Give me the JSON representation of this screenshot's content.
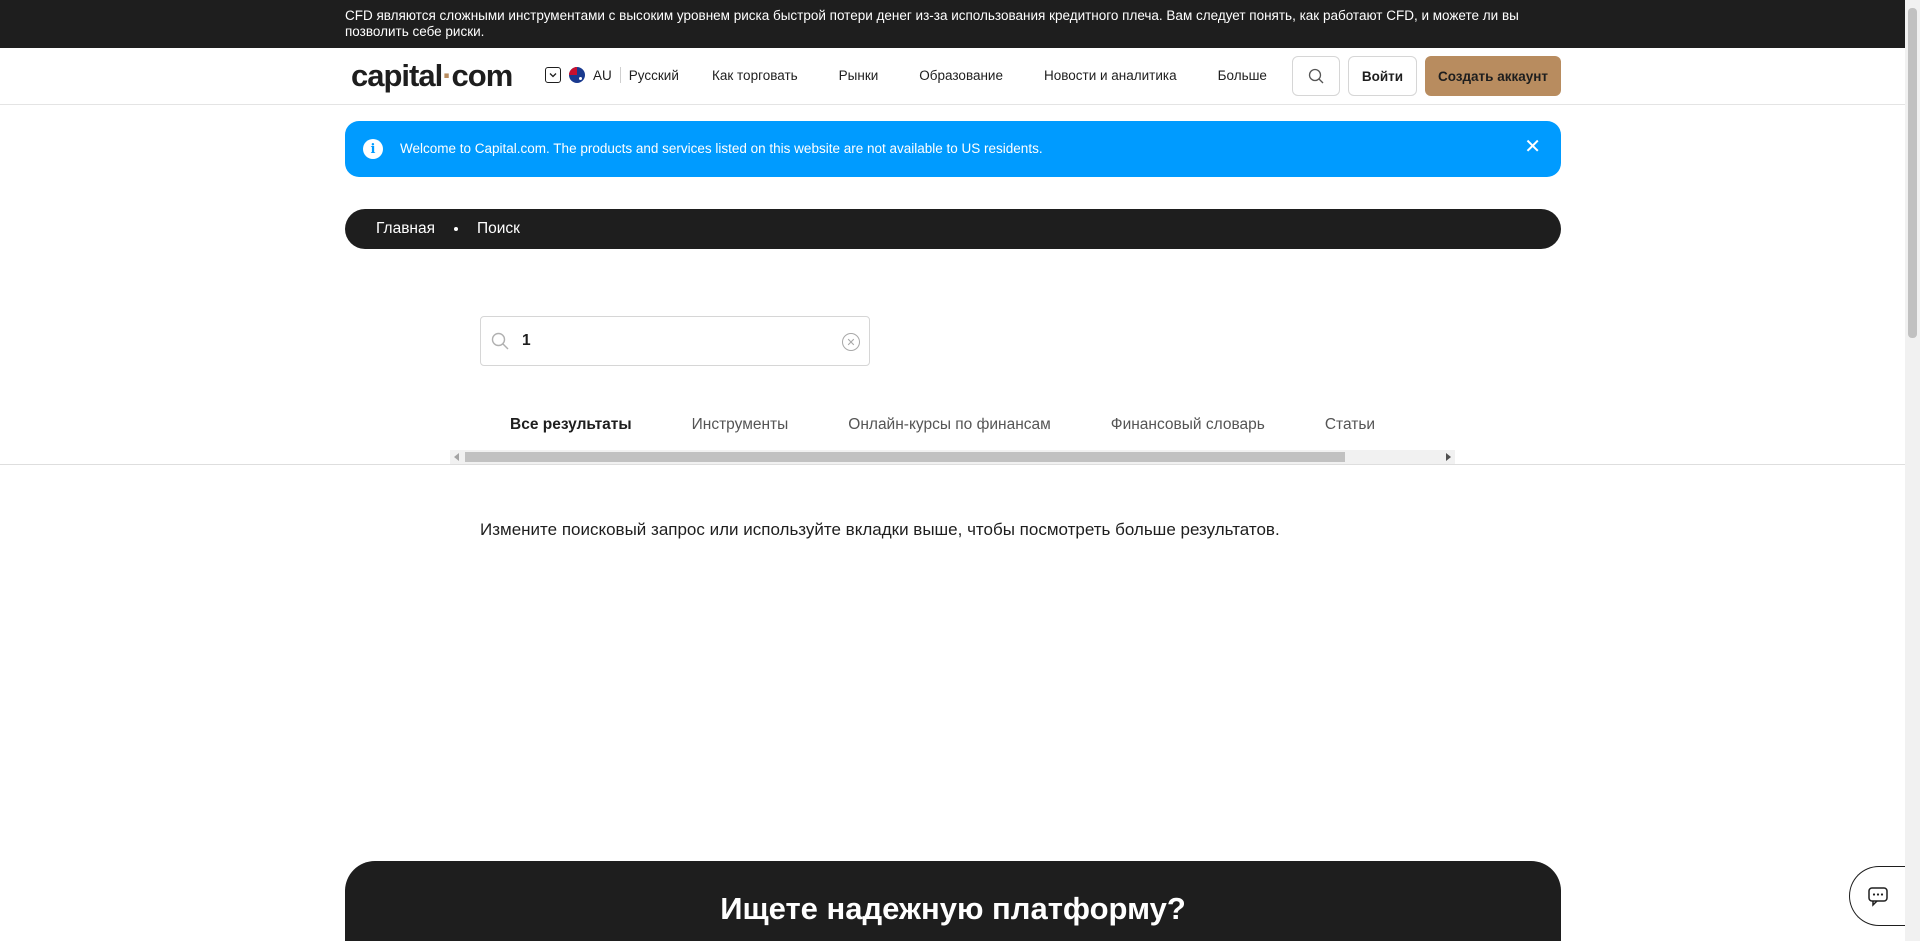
{
  "risk_warning": "CFD являются сложными инструментами с высоким уровнем риска быстрой потери денег из-за использования кредитного плеча. Вам следует понять, как работают CFD, и можете ли вы позволить себе риски.",
  "header": {
    "logo_left": "capital",
    "logo_dot": "·",
    "logo_right": "com",
    "region": "AU",
    "language": "Русский",
    "nav": [
      "Как торговать",
      "Рынки",
      "Образование",
      "Новости и аналитика",
      "Больше"
    ],
    "login_label": "Войти",
    "signup_label": "Создать аккаунт"
  },
  "notice": {
    "icon": "info-icon",
    "message": "Welcome to Capital.com. The products and services listed on this website are not available to US residents.",
    "close": "✕"
  },
  "breadcrumb": [
    "Главная",
    "Поиск"
  ],
  "search": {
    "value": "1"
  },
  "tabs": [
    {
      "label": "Все результаты",
      "active": true
    },
    {
      "label": "Инструменты",
      "active": false
    },
    {
      "label": "Онлайн-курсы по финансам",
      "active": false
    },
    {
      "label": "Финансовый словарь",
      "active": false
    },
    {
      "label": "Статьи",
      "active": false
    }
  ],
  "hint": "Измените поисковый запрос или используйте вкладки выше, чтобы посмотреть больше результатов.",
  "cta_title": "Ищете надежную платформу?",
  "colors": {
    "accent": "#b88c5f",
    "notice": "#009bff",
    "dark": "#1e1e1e"
  }
}
